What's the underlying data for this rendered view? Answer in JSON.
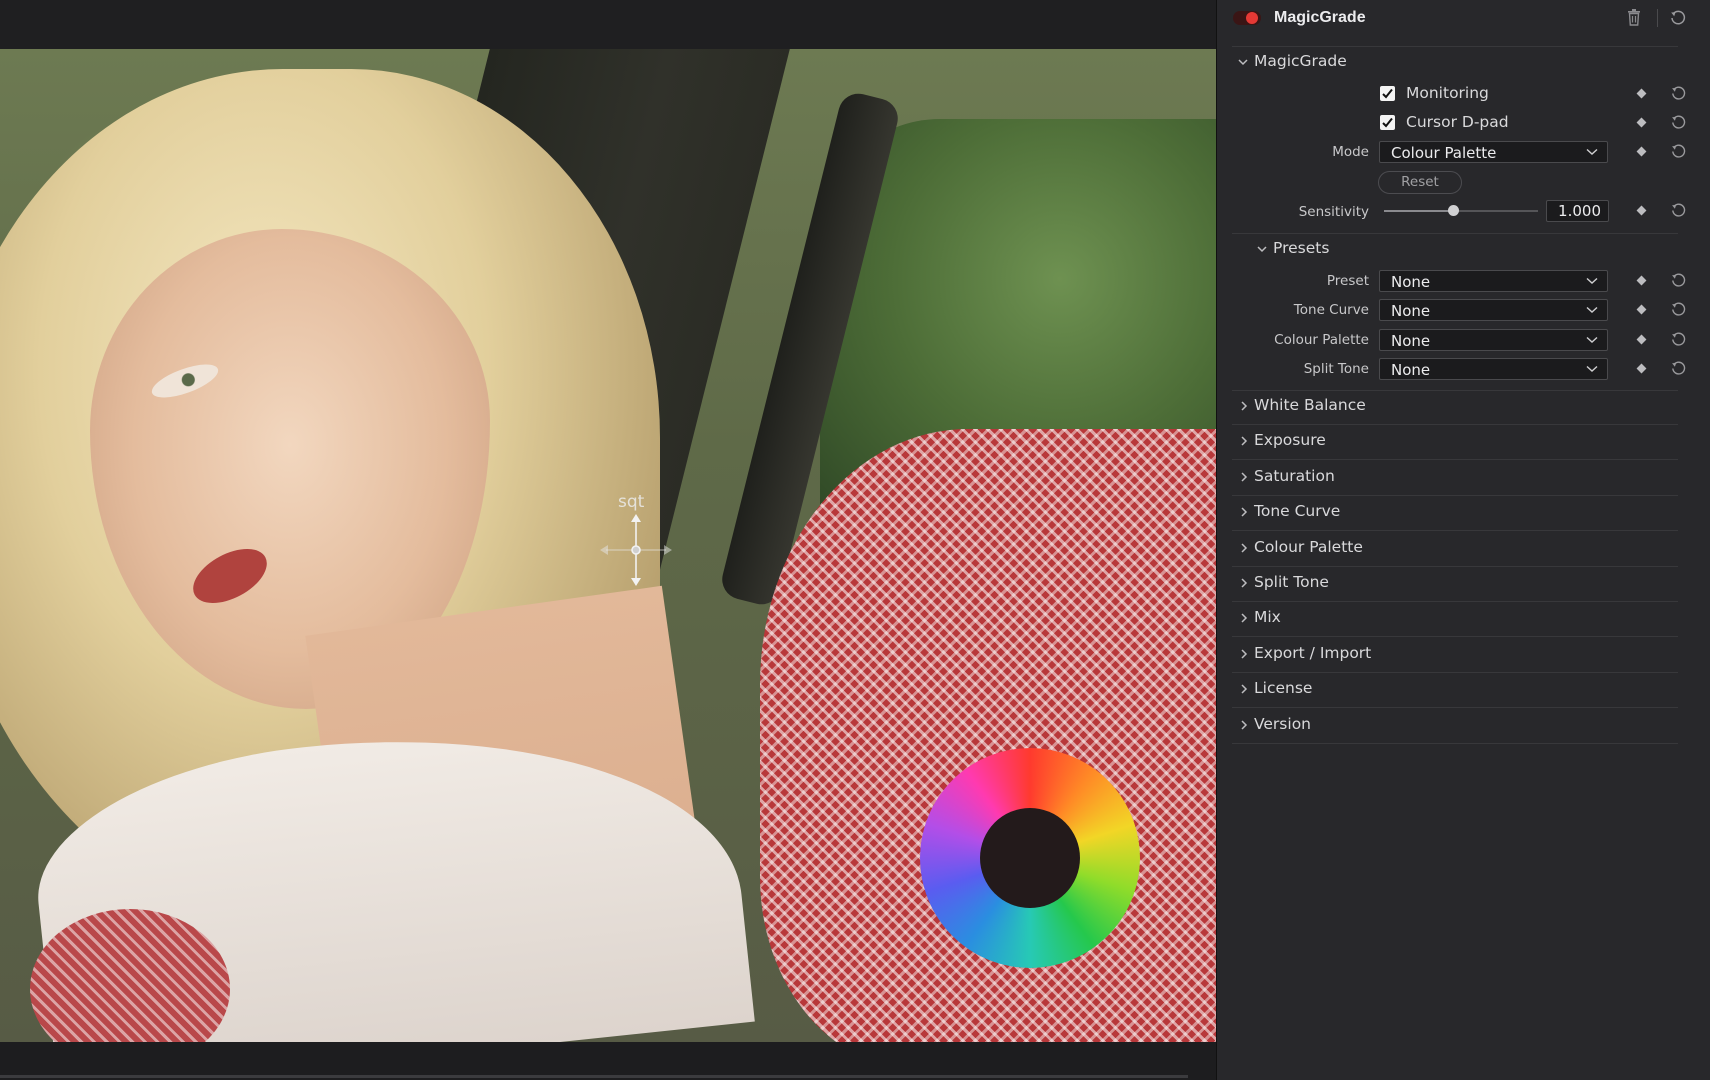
{
  "viewer": {
    "cursor_label": "sqt"
  },
  "plugin": {
    "name": "MagicGrade",
    "enabled": true,
    "accent_color": "#e53935"
  },
  "magicgrade": {
    "section_title": "MagicGrade",
    "monitoring": {
      "label": "Monitoring",
      "checked": true
    },
    "cursor_dpad": {
      "label": "Cursor D-pad",
      "checked": true
    },
    "mode": {
      "label": "Mode",
      "value": "Colour Palette"
    },
    "reset_label": "Reset",
    "sensitivity": {
      "label": "Sensitivity",
      "value": "1.000",
      "slider_fraction": 0.45
    }
  },
  "presets": {
    "section_title": "Presets",
    "preset": {
      "label": "Preset",
      "value": "None"
    },
    "tone_curve": {
      "label": "Tone Curve",
      "value": "None"
    },
    "colour_palette": {
      "label": "Colour Palette",
      "value": "None"
    },
    "split_tone": {
      "label": "Split Tone",
      "value": "None"
    }
  },
  "collapsed_sections": [
    "White Balance",
    "Exposure",
    "Saturation",
    "Tone Curve",
    "Colour Palette",
    "Split Tone",
    "Mix",
    "Export / Import",
    "License",
    "Version"
  ],
  "icons": {
    "keyframe": "keyframe-diamond-icon",
    "reset": "reset-icon",
    "delete": "trash-icon",
    "expand": "chevron-icon"
  }
}
